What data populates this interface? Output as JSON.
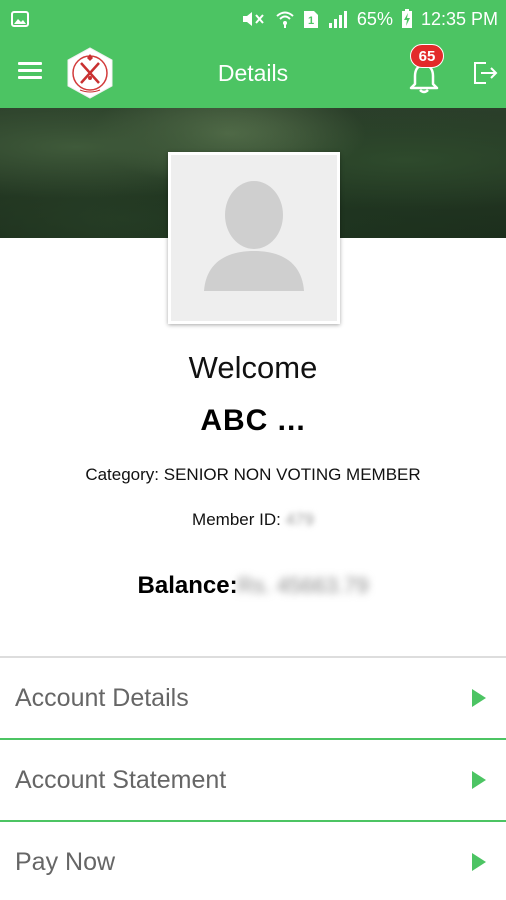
{
  "status_bar": {
    "battery": "65%",
    "time": "12:35 PM",
    "sim": "1"
  },
  "app_bar": {
    "title": "Details",
    "notification_count": "65"
  },
  "profile": {
    "welcome": "Welcome",
    "name": "ABC  ...",
    "category_label": "Category:",
    "category_value": "SENIOR NON VOTING MEMBER",
    "member_id_label": "Member ID:",
    "member_id_value": "479",
    "balance_label": "Balance:",
    "balance_value": "Rs. 45663.79"
  },
  "menu": {
    "items": [
      {
        "label": "Account Details"
      },
      {
        "label": "Account Statement"
      },
      {
        "label": "Pay Now"
      }
    ]
  },
  "colors": {
    "primary": "#4cc463",
    "badge": "#e32a2a"
  }
}
